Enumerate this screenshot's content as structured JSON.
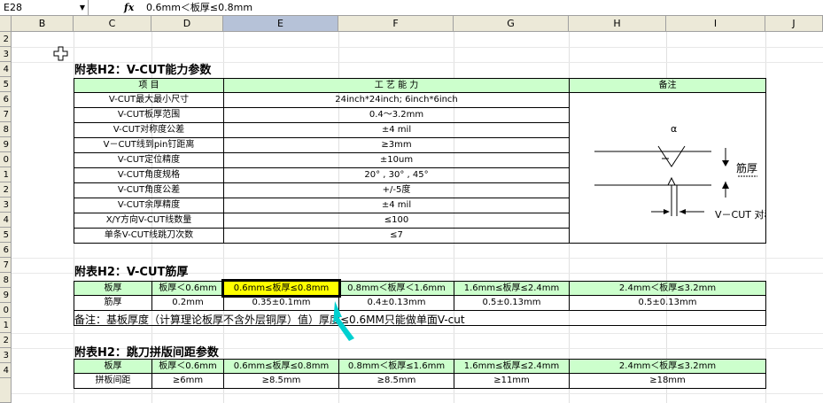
{
  "formula_bar": {
    "name_box": "E28",
    "fx": "fx",
    "content": "0.6mm＜板厚≤0.8mm"
  },
  "columns": [
    "B",
    "C",
    "D",
    "E",
    "F",
    "G",
    "H",
    "I",
    "J"
  ],
  "rows": [
    "2",
    "3",
    "4",
    "5",
    "6",
    "7",
    "8",
    "9",
    "0",
    "1",
    "2",
    "3",
    "4",
    "5",
    "6",
    "7",
    "8",
    "9",
    "0",
    "1",
    "2",
    "3",
    "4"
  ],
  "section1": {
    "title": "附表H2：V-CUT能力参数",
    "header": {
      "item": "项 目",
      "capability": "工 艺 能 力",
      "remark": "备注"
    },
    "rows": [
      {
        "item": "V-CUT最大最小尺寸",
        "value": "24inch*24inch; 6inch*6inch"
      },
      {
        "item": "V-CUT板厚范围",
        "value": "0.4～3.2mm"
      },
      {
        "item": "V-CUT对称度公差",
        "value": "±4 mil"
      },
      {
        "item": "V－CUT线到pin钉距离",
        "value": "≥3mm"
      },
      {
        "item": "V-CUT定位精度",
        "value": "±10um"
      },
      {
        "item": "V-CUT角度规格",
        "value": "20° , 30° , 45°"
      },
      {
        "item": "V-CUT角度公差",
        "value": "+/-5度"
      },
      {
        "item": "V-CUT余厚精度",
        "value": "±4 mil"
      },
      {
        "item": "X/Y方向V-CUT线数量",
        "value": "≤100"
      },
      {
        "item": "单条V-CUT线跳刀次数",
        "value": "≤7"
      }
    ],
    "diagram": {
      "alpha": "α",
      "thickness_label": "筋厚",
      "symmetry_label": "V－CUT 对称度"
    }
  },
  "section2": {
    "title": "附表H2：V-CUT筋厚",
    "header": [
      "板厚",
      "板厚＜0.6mm",
      "0.6mm≤板厚≤0.8mm",
      "0.8mm＜板厚＜1.6mm",
      "1.6mm≤板厚≤2.4mm",
      "2.4mm＜板厚≤3.2mm"
    ],
    "values": [
      "筋厚",
      "0.2mm",
      "0.35±0.1mm",
      "0.4±0.13mm",
      "0.5±0.13mm",
      "0.5±0.13mm"
    ],
    "note": "备注：基板厚度（计算理论板厚不含外层铜厚）值）厚度≤0.6MM只能做单面V-cut"
  },
  "section3": {
    "title": "附表H2：跳刀拼版间距参数",
    "header": [
      "板厚",
      "板厚＜0.6mm",
      "0.6mm≤板厚≤0.8mm",
      "0.8mm＜板厚≤1.6mm",
      "1.6mm≤板厚≤2.4mm",
      "2.4mm＜板厚≤3.2mm"
    ],
    "values": [
      "拼板间距",
      "≥6mm",
      "≥8.5mm",
      "≥8.5mm",
      "≥11mm",
      "≥18mm"
    ]
  },
  "colors": {
    "header_green": "#ccffcc",
    "selected_yellow": "#ffff00",
    "cursor_cyan": "#00d0d0"
  }
}
